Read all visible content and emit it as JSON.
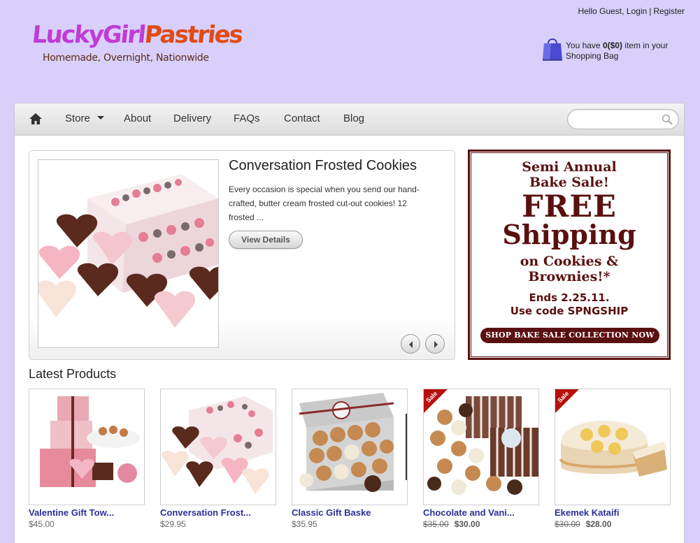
{
  "header": {
    "greeting": "Hello Guest, ",
    "login": "Login",
    "separator": "|",
    "register": "Register",
    "logo_part1": "LuckyGirl",
    "logo_part2": "Pastries",
    "tagline": "Homemade, Overnight, Nationwide",
    "bag_prefix": "You have ",
    "bag_count": "0($0)",
    "bag_suffix": " item in your",
    "bag_line2": "Shopping Bag"
  },
  "nav": {
    "items": [
      {
        "label": "Store"
      },
      {
        "label": "About"
      },
      {
        "label": "Delivery"
      },
      {
        "label": "FAQs"
      },
      {
        "label": "Contact"
      },
      {
        "label": "Blog"
      }
    ],
    "search_placeholder": ""
  },
  "feature": {
    "title": "Conversation Frosted Cookies",
    "description": "Every occasion is special when you send our hand-crafted, butter cream frosted cut-out cookies! 12 frosted ...",
    "button": "View Details"
  },
  "promo": {
    "line1a": "Semi Annual",
    "line1b": "Bake Sale!",
    "free": "FREE",
    "shipping": "Shipping",
    "line3a": "on Cookies &",
    "line3b": "Brownies!*",
    "line4a": "Ends 2.25.11.",
    "line4b": "Use code SPNGSHIP",
    "button": "SHOP BAKE SALE COLLECTION NOW"
  },
  "latest": {
    "title": "Latest Products",
    "sale_label": "Sale",
    "products": [
      {
        "name": "Valentine Gift Tow...",
        "price": "$45.00",
        "old_price": "",
        "sale": false
      },
      {
        "name": "Conversation Frost...",
        "price": "$29.95",
        "old_price": "",
        "sale": false
      },
      {
        "name": "Classic Gift Baske",
        "price": "$35.95",
        "old_price": "",
        "sale": false
      },
      {
        "name": "Chocolate and Vani...",
        "price": "$30.00",
        "old_price": "$35.00",
        "sale": true
      },
      {
        "name": "Ekemek Kataifi",
        "price": "$28.00",
        "old_price": "$30.00",
        "sale": true
      }
    ]
  },
  "colors": {
    "page_bg": "#d8d0fb",
    "logo_pink": "#c13bd6",
    "logo_orange": "#e04b16",
    "product_link": "#2c2f99",
    "promo_maroon": "#5a1010",
    "sale_red": "#b80f0f"
  },
  "icons": [
    "home-icon",
    "shopping-bag-icon",
    "search-icon",
    "arrow-left-icon",
    "arrow-right-icon"
  ]
}
